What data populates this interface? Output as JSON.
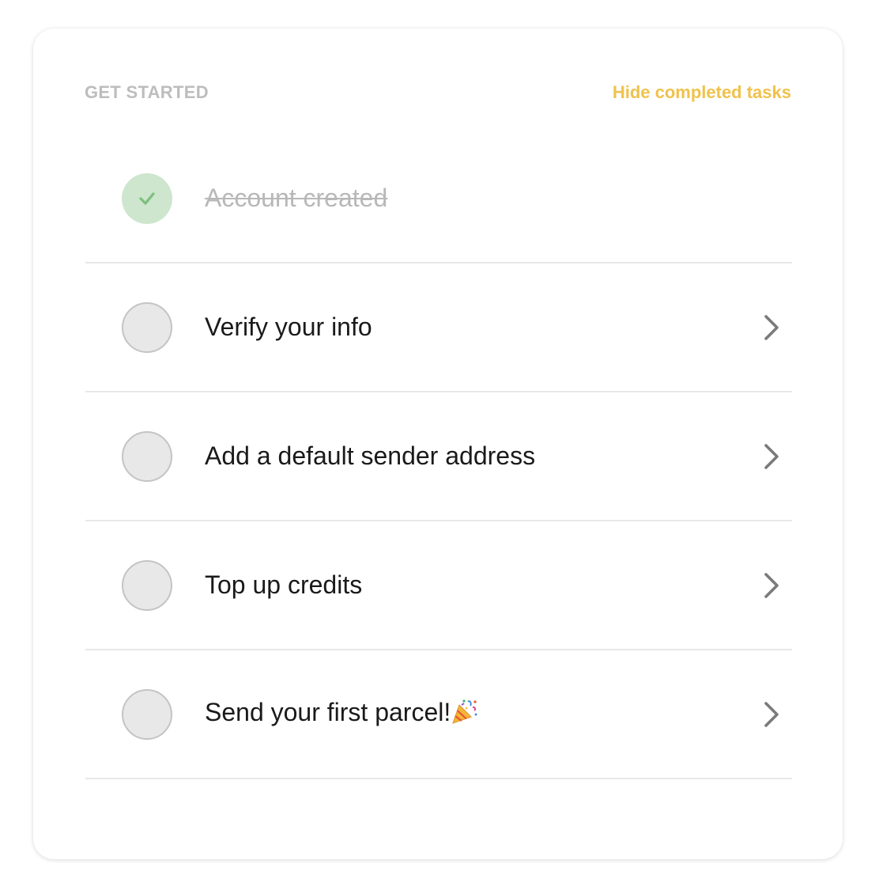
{
  "header": {
    "title": "GET STARTED",
    "hide_completed_label": "Hide completed tasks"
  },
  "tasks": [
    {
      "label": "Account created",
      "completed": true,
      "status_icon": "check-icon"
    },
    {
      "label": "Verify your info",
      "completed": false,
      "action_icon": "chevron-right-icon"
    },
    {
      "label": "Add a default sender address",
      "completed": false,
      "action_icon": "chevron-right-icon"
    },
    {
      "label": "Top up credits",
      "completed": false,
      "action_icon": "chevron-right-icon"
    },
    {
      "label": "Send your first parcel!",
      "completed": false,
      "emoji": "party-popper-icon",
      "action_icon": "chevron-right-icon"
    }
  ],
  "colors": {
    "accent": "#f0c24b",
    "completed_circle": "#cde6cd",
    "check": "#7dbf7d",
    "pending_circle": "#e8e8e8",
    "divider": "#e8e8e8",
    "chevron": "#7a7a7a"
  }
}
